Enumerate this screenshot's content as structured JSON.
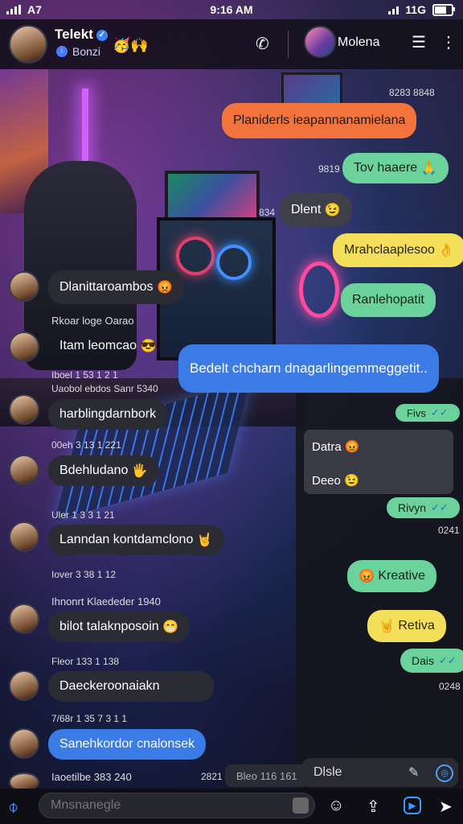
{
  "status_bar": {
    "carrier": "A7",
    "time": "9:16 AM",
    "network": "11G"
  },
  "header": {
    "name": "Telekt",
    "subtitle": "Bonzi",
    "subtitle_icon": "info-icon",
    "emoji": "🥳🙌",
    "contact_name": "Molena"
  },
  "messages_right": [
    {
      "meta": "8283 8848",
      "text": "Planiderls ieapannanamielana",
      "color": "orange"
    },
    {
      "meta": "9819",
      "text": "Tov haaere",
      "emoji": "🙏",
      "color": "green"
    },
    {
      "meta": "834",
      "text": "Dlent",
      "emoji": "😉",
      "color": "gray"
    },
    {
      "text": "Mrahclaaplesoo",
      "emoji": "👌",
      "color": "yellow"
    },
    {
      "text": "Ranlehopatit",
      "color": "green"
    },
    {
      "text": "Bedelt chcharn dnagarlingemmeggetit..",
      "color": "blue"
    }
  ],
  "messages_left": [
    {
      "text": "Dlanittaroambos",
      "emoji": "😡",
      "meta": "Rkoar loge Oarao"
    },
    {
      "text": "Itam leomcao",
      "emoji": "😎",
      "meta": "Iboel 1 53 1 2 1\nUaobol ebdos Sanr 5340"
    },
    {
      "text": "harblingdarnbork",
      "meta": "00eh 3 13 1 221"
    },
    {
      "text": "Bdehludano",
      "emoji": "🖐",
      "meta": "Uler 1 3 3 1 21"
    },
    {
      "text": "Lanndan kontdamclono",
      "emoji": "🤘",
      "meta": "Iover 3 38 1 12"
    },
    {
      "text": "bilot talaknposoin",
      "emoji": "😁",
      "meta": "Ihnonrt Klaededer 1940"
    },
    {
      "text": "Daeckeroonaiakn",
      "meta": "Fleor 133 1 138"
    },
    {
      "text": "Sanehkordor cnalonsek",
      "meta": "7/68r 1 35 7 3 1 1"
    },
    {
      "text": "Iaoetilbe 383 240",
      "meta": ""
    }
  ],
  "side_panel": {
    "tick_label_1": "Fivs",
    "card_line_1": "Datra",
    "card_emoji_1": "😡",
    "card_line_2": "Deeo",
    "card_emoji_2": "😉",
    "reply_1": "Rivyn",
    "reply_1_time": "0241",
    "reply_2": "Kreative",
    "reply_2_emoji": "😡",
    "reply_3": "Retiva",
    "reply_3_emoji": "🤘",
    "reply_4": "Dais",
    "reply_4_time": "0248",
    "bottom_meta": "2821",
    "bottom_pill": "Bleo 116 161"
  },
  "composer": {
    "placeholder": "Mnsnanegle",
    "side_text": "Dlsle"
  },
  "colors": {
    "accent": "#3a7be6",
    "orange": "#f3733d",
    "green": "#6ad29a",
    "yellow": "#f3df5a"
  }
}
